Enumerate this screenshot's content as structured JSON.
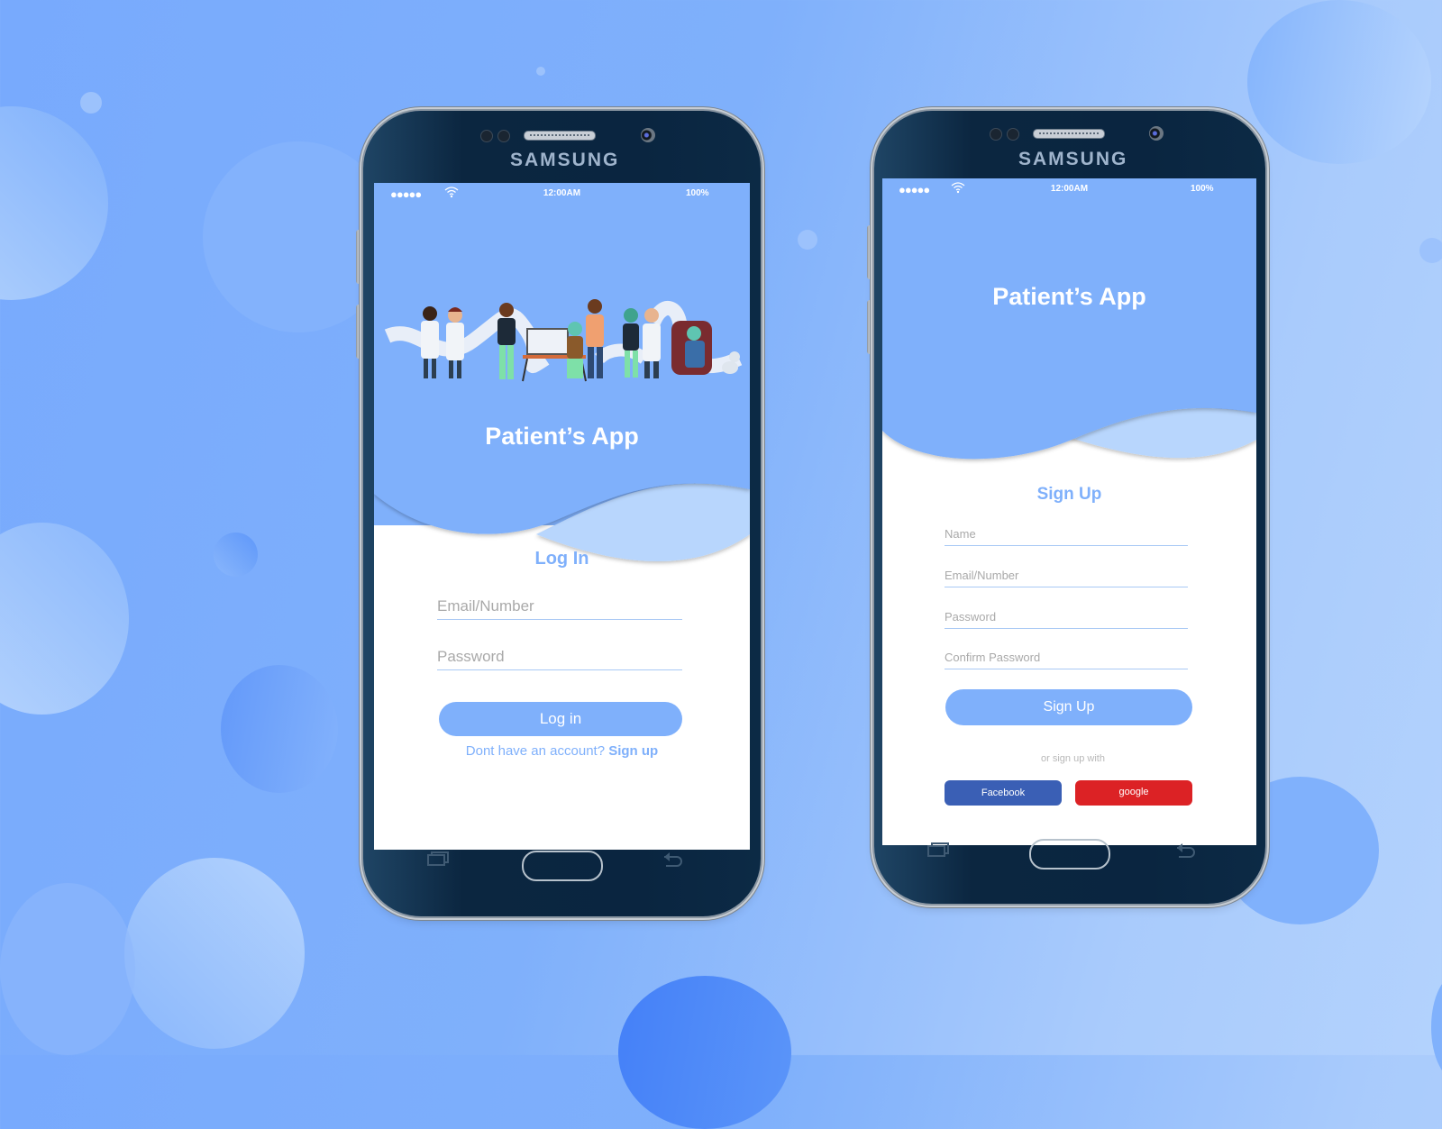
{
  "colors": {
    "accent": "#7fb0fb",
    "accent_light": "#b8d6fd",
    "facebook": "#3a5fb5",
    "google": "#dc2225",
    "phone_body": "#0a2540"
  },
  "login_phone": {
    "brand": "SAMSUNG",
    "status_bar": {
      "signal": "●●●●●",
      "wifi_icon": "wifi-icon",
      "time": "12:00AM",
      "battery": "100%"
    },
    "illustration": "healthcare-team-illustration",
    "app_title": "Patient’s App",
    "section_title": "Log In",
    "fields": [
      {
        "placeholder": "Email/Number",
        "value": ""
      },
      {
        "placeholder": "Password",
        "value": ""
      }
    ],
    "submit_label": "Log in",
    "footer_text": "Dont have an account?",
    "footer_link": "Sign up",
    "nav": {
      "recent_icon": "recent-apps-icon",
      "home_icon": "home-button",
      "back_icon": "back-icon"
    }
  },
  "signup_phone": {
    "brand": "SAMSUNG",
    "status_bar": {
      "signal": "●●●●●",
      "wifi_icon": "wifi-icon",
      "time": "12:00AM",
      "battery": "100%"
    },
    "app_title": "Patient’s App",
    "section_title": "Sign Up",
    "fields": [
      {
        "placeholder": "Name",
        "value": ""
      },
      {
        "placeholder": "Email/Number",
        "value": ""
      },
      {
        "placeholder": "Password",
        "value": ""
      },
      {
        "placeholder": "Confirm Password",
        "value": ""
      }
    ],
    "submit_label": "Sign Up",
    "alt_text": "or sign up with",
    "social": {
      "facebook_label": "Facebook",
      "google_label": "google"
    },
    "nav": {
      "recent_icon": "recent-apps-icon",
      "home_icon": "home-button",
      "back_icon": "back-icon"
    }
  }
}
